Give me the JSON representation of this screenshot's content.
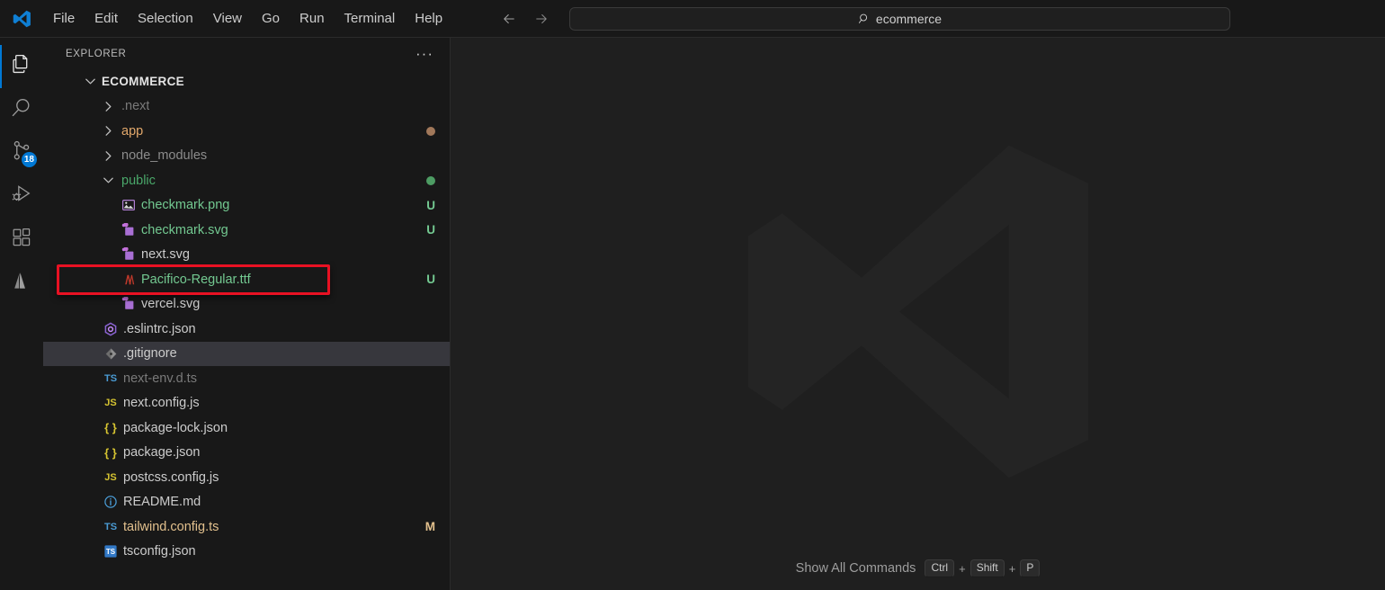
{
  "titlebar": {
    "logo_icon": "vscode-logo-icon",
    "menus": [
      "File",
      "Edit",
      "Selection",
      "View",
      "Go",
      "Run",
      "Terminal",
      "Help"
    ],
    "nav_back_icon": "arrow-left-icon",
    "nav_forward_icon": "arrow-right-icon",
    "command_center": {
      "search_icon": "search-icon",
      "value": "ecommerce"
    }
  },
  "activitybar": {
    "items": [
      {
        "name": "explorer",
        "icon": "files-icon",
        "active": true,
        "badge": null
      },
      {
        "name": "search",
        "icon": "search-icon",
        "active": false,
        "badge": null
      },
      {
        "name": "source-control",
        "icon": "source-control-icon",
        "active": false,
        "badge": "18"
      },
      {
        "name": "run-and-debug",
        "icon": "run-debug-icon",
        "active": false,
        "badge": null
      },
      {
        "name": "extensions",
        "icon": "extensions-icon",
        "active": false,
        "badge": null
      },
      {
        "name": "azure",
        "icon": "azure-icon",
        "active": false,
        "badge": null
      }
    ]
  },
  "sidebar": {
    "title": "EXPLORER",
    "more_actions_icon": "ellipsis-icon",
    "root": {
      "label": "ECOMMERCE",
      "expanded": true
    },
    "tree": [
      {
        "label": ".next",
        "type": "folder",
        "expanded": false,
        "depth": 1,
        "color": "#7a7a7a",
        "icon": "chevron-right-icon",
        "status": "",
        "dot": ""
      },
      {
        "label": "app",
        "type": "folder",
        "expanded": false,
        "depth": 1,
        "color": "#e2a86b",
        "icon": "chevron-right-icon",
        "status": "",
        "dot": "#a1785a"
      },
      {
        "label": "node_modules",
        "type": "folder",
        "expanded": false,
        "depth": 1,
        "color": "#8c8c8c",
        "icon": "chevron-right-icon",
        "status": "",
        "dot": ""
      },
      {
        "label": "public",
        "type": "folder",
        "expanded": true,
        "depth": 1,
        "color": "#4aa86a",
        "icon": "chevron-down-icon",
        "status": "",
        "dot": "#4d9c63"
      },
      {
        "label": "checkmark.png",
        "type": "file",
        "depth": 2,
        "color": "#73c991",
        "icon": "image-file-icon",
        "status": "U",
        "status_color": "#73c991"
      },
      {
        "label": "checkmark.svg",
        "type": "file",
        "depth": 2,
        "color": "#73c991",
        "icon": "svg-file-icon",
        "status": "U",
        "status_color": "#73c991"
      },
      {
        "label": "next.svg",
        "type": "file",
        "depth": 2,
        "color": "#cccccc",
        "icon": "svg-file-icon",
        "status": "",
        "status_color": ""
      },
      {
        "label": "Pacifico-Regular.ttf",
        "type": "file",
        "depth": 2,
        "color": "#73c991",
        "icon": "font-file-icon",
        "status": "U",
        "status_color": "#73c991",
        "highlighted": true
      },
      {
        "label": "vercel.svg",
        "type": "file",
        "depth": 2,
        "color": "#cccccc",
        "icon": "svg-file-icon",
        "status": "",
        "status_color": ""
      },
      {
        "label": ".eslintrc.json",
        "type": "file",
        "depth": 1,
        "color": "#cccccc",
        "icon": "eslint-file-icon",
        "status": "",
        "status_color": ""
      },
      {
        "label": ".gitignore",
        "type": "file",
        "depth": 1,
        "color": "#cccccc",
        "icon": "git-file-icon",
        "status": "",
        "status_color": "",
        "selected": true
      },
      {
        "label": "next-env.d.ts",
        "type": "file",
        "depth": 1,
        "color": "#7a7a7a",
        "icon": "ts-file-icon",
        "status": "",
        "status_color": ""
      },
      {
        "label": "next.config.js",
        "type": "file",
        "depth": 1,
        "color": "#cccccc",
        "icon": "js-file-icon",
        "status": "",
        "status_color": ""
      },
      {
        "label": "package-lock.json",
        "type": "file",
        "depth": 1,
        "color": "#cccccc",
        "icon": "json-file-icon",
        "status": "",
        "status_color": ""
      },
      {
        "label": "package.json",
        "type": "file",
        "depth": 1,
        "color": "#cccccc",
        "icon": "json-file-icon",
        "status": "",
        "status_color": ""
      },
      {
        "label": "postcss.config.js",
        "type": "file",
        "depth": 1,
        "color": "#cccccc",
        "icon": "js-file-icon",
        "status": "",
        "status_color": ""
      },
      {
        "label": "README.md",
        "type": "file",
        "depth": 1,
        "color": "#cccccc",
        "icon": "markdown-file-icon",
        "status": "",
        "status_color": ""
      },
      {
        "label": "tailwind.config.ts",
        "type": "file",
        "depth": 1,
        "color": "#e2c08d",
        "icon": "ts-file-icon",
        "status": "M",
        "status_color": "#e2c08d"
      },
      {
        "label": "tsconfig.json",
        "type": "file",
        "depth": 1,
        "color": "#cccccc",
        "icon": "tsconfig-file-icon",
        "status": "",
        "status_color": ""
      }
    ]
  },
  "editor": {
    "watermark_logo_icon": "vscode-watermark-logo-icon",
    "shortcuts": [
      {
        "label": "Show All Commands",
        "keys": [
          "Ctrl",
          "Shift",
          "P"
        ],
        "separator": "+"
      }
    ]
  },
  "annotation": {
    "highlight_color": "#e81123",
    "target": "Pacifico-Regular.ttf"
  }
}
